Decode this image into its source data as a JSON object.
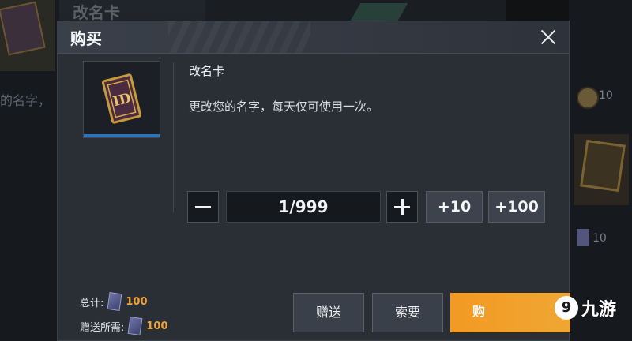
{
  "background": {
    "left_title_fragment": "改名卡",
    "left_text_fragment": "的名字，",
    "right_price_1": "10",
    "right_price_2": "10"
  },
  "dialog": {
    "title": "购买",
    "item": {
      "name": "改名卡",
      "description": "更改您的名字，每天仅可使用一次。",
      "icon": "rename-card-icon"
    },
    "quantity": {
      "value": "1/999",
      "minus_icon": "minus-icon",
      "plus_icon": "plus-icon",
      "add_ten_label": "+10",
      "add_hundred_label": "+100"
    },
    "totals": {
      "total_label": "总计:",
      "total_value": "100",
      "gift_label": "赠送所需:",
      "gift_value": "100",
      "currency_icon": "card-currency-icon"
    },
    "actions": {
      "gift_label": "赠送",
      "request_label": "索要",
      "buy_label": "购"
    }
  },
  "watermark": {
    "logo_text": "9",
    "text": "九游"
  },
  "colors": {
    "accent_orange": "#f29a22",
    "price_orange": "#f0a33a",
    "selection_blue": "#2f74b8",
    "dialog_bg": "#2a2f36"
  }
}
